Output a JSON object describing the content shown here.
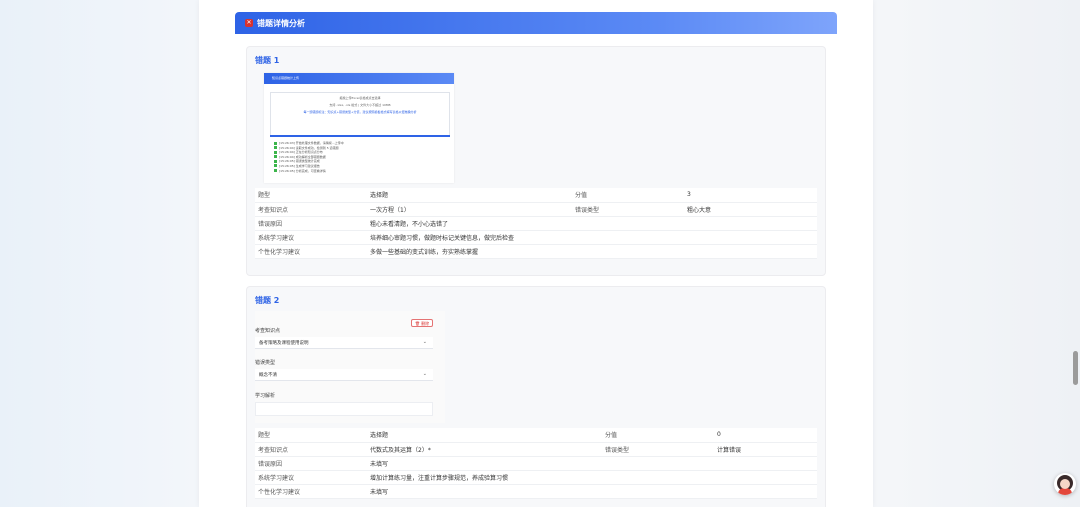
{
  "section": {
    "title": "错题详情分析",
    "icon": "x-icon"
  },
  "errors": [
    {
      "title": "错题 1",
      "screenshot": {
        "bar_title": "知识点错题统计上传",
        "line1": "拖拽上传Excel表格或点击选择",
        "line2": "支持 .xlsx, .xls 格式 | 文件大小不超过 10MB",
        "link": "每一题错题标注：知识点+错误类型+分值，建议按照模板格式填写表格以便准确分析",
        "logs": [
          "[15:26:03] 开始处理文件数据，请稍候...上传中",
          "[15:26:04] 读取文件成功，检测到 5 道错题",
          "[15:26:04] 正在分析知识点分布",
          "[15:26:04] 成功解析全部错题数据",
          "[15:26:05] 错误类型统计完成",
          "[15:26:05] 生成学习建议报告",
          "[15:26:05] 分析完成，可查看详情"
        ]
      },
      "rows": [
        {
          "l1": "题型",
          "v1": "选择题",
          "l2": "分值",
          "v2": "3"
        },
        {
          "l1": "考查知识点",
          "v1": "一次方程（1）",
          "l2": "错误类型",
          "v2": "粗心大意"
        },
        {
          "l1": "错误原因",
          "v1": "粗心未看清题，不小心选错了"
        },
        {
          "l1": "系统学习建议",
          "v1": "培养细心审题习惯，做题时标记关键信息，做完后检查"
        },
        {
          "l1": "个性化学习建议",
          "v1": "多做一些基础的变式训练，夯实熟练掌握"
        }
      ]
    },
    {
      "title": "错题 2",
      "screenshot": {
        "knowledge_label": "考查知识点",
        "delete_label": "删除",
        "knowledge_value": "备考策略及课程使用说明",
        "type_label": "错误类型",
        "type_value": "概念不清",
        "analysis_label": "学习解析"
      },
      "rows": [
        {
          "l1": "题型",
          "v1": "选择题",
          "l2": "分值",
          "v2": "0"
        },
        {
          "l1": "考查知识点",
          "v1": "代数式及其运算（2）*",
          "l2": "错误类型",
          "v2": "计算错误"
        },
        {
          "l1": "错误原因",
          "v1": "未填写"
        },
        {
          "l1": "系统学习建议",
          "v1": "增加计算练习量，注重计算步骤规范，养成验算习惯"
        },
        {
          "l1": "个性化学习建议",
          "v1": "未填写"
        }
      ]
    }
  ]
}
